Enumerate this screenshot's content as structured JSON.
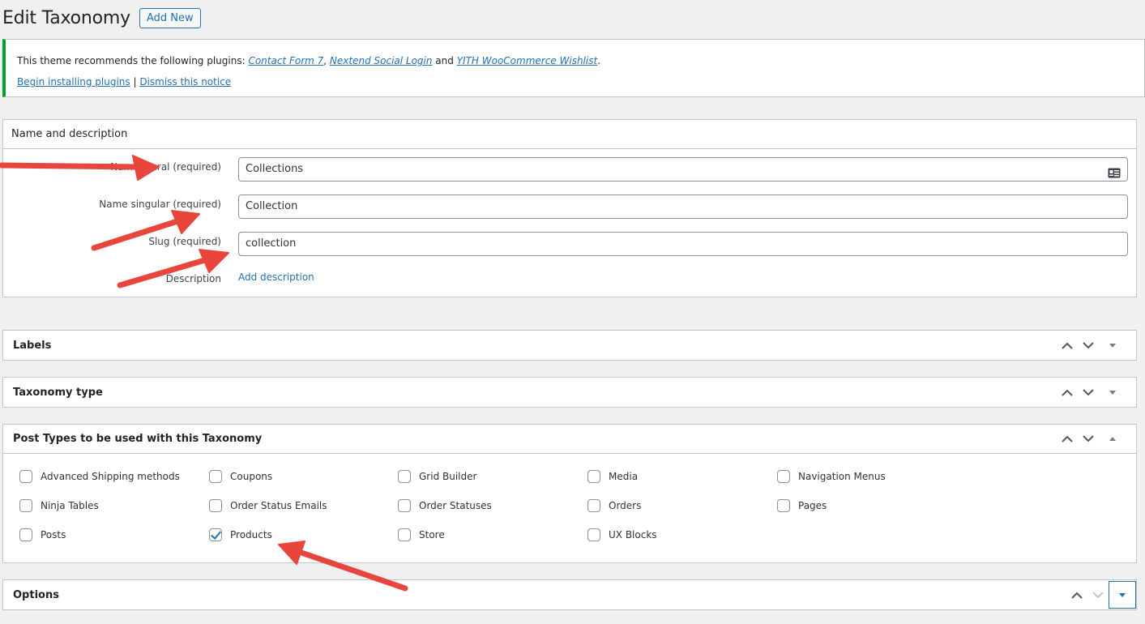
{
  "header": {
    "title": "Edit Taxonomy",
    "add_new": "Add New"
  },
  "notice": {
    "text_prefix": "This theme recommends the following plugins: ",
    "plugins": [
      "Contact Form 7",
      "Nextend Social Login",
      "YITH WooCommerce Wishlist"
    ],
    "sep1": ", ",
    "and": " and ",
    "period": ".",
    "begin_link": "Begin installing plugins",
    "divider": " | ",
    "dismiss_link": "Dismiss this notice",
    "accent_color": "#00a32a"
  },
  "name_desc": {
    "title": "Name and description",
    "plural_label": "Name plural",
    "singular_label": "Name singular",
    "slug_label": "Slug",
    "required": "(required)",
    "description_label": "Description",
    "plural_value": "Collections",
    "singular_value": "Collection",
    "slug_value": "collection",
    "add_description": "Add description"
  },
  "boxes": {
    "labels": "Labels",
    "taxonomy_type": "Taxonomy type",
    "post_types": "Post Types to be used with this Taxonomy",
    "options": "Options"
  },
  "post_types": [
    {
      "label": "Advanced Shipping methods",
      "checked": false
    },
    {
      "label": "Coupons",
      "checked": false
    },
    {
      "label": "Grid Builder",
      "checked": false
    },
    {
      "label": "Media",
      "checked": false
    },
    {
      "label": "Navigation Menus",
      "checked": false
    },
    {
      "label": "Ninja Tables",
      "checked": false
    },
    {
      "label": "Order Status Emails",
      "checked": false
    },
    {
      "label": "Order Statuses",
      "checked": false
    },
    {
      "label": "Orders",
      "checked": false
    },
    {
      "label": "Pages",
      "checked": false
    },
    {
      "label": "Posts",
      "checked": false
    },
    {
      "label": "Products",
      "checked": true
    },
    {
      "label": "Store",
      "checked": false
    },
    {
      "label": "UX Blocks",
      "checked": false
    }
  ],
  "colors": {
    "link": "#2271b1",
    "annotation_arrow": "#e8453c"
  }
}
